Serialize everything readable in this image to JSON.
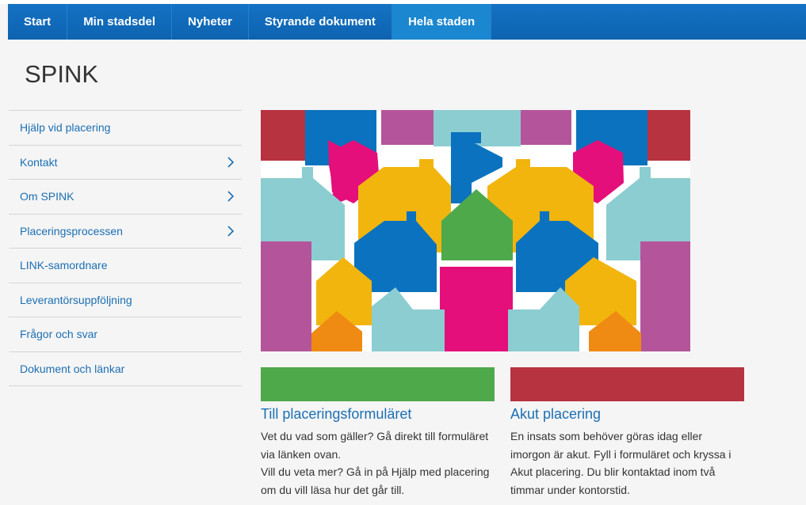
{
  "nav": {
    "items": [
      {
        "label": "Start"
      },
      {
        "label": "Min stadsdel"
      },
      {
        "label": "Nyheter"
      },
      {
        "label": "Styrande dokument"
      },
      {
        "label": "Hela staden"
      }
    ]
  },
  "page": {
    "title": "SPINK"
  },
  "sidebar": {
    "items": [
      {
        "label": "Hjälp vid placering"
      },
      {
        "label": "Kontakt"
      },
      {
        "label": "Om SPINK"
      },
      {
        "label": "Placeringsprocessen"
      },
      {
        "label": "LINK-samordnare"
      },
      {
        "label": "Leverantörsuppföljning"
      },
      {
        "label": "Frågor och svar"
      },
      {
        "label": "Dokument och länkar"
      }
    ]
  },
  "cards": [
    {
      "color": "#4ea94b",
      "title": "Till placeringsformuläret",
      "text1": "Vet du vad som gäller? Gå direkt till formuläret via länken ovan.",
      "text2": "Vill du veta mer? Gå in på Hjälp med placering om du vill läsa hur det går till."
    },
    {
      "color": "#b73340",
      "title": "Akut placering",
      "text1": "En insats som behöver göras idag eller imorgon är akut. Fyll i formuläret och kryssa i Akut placering. Du blir kontaktad inom två timmar under kontorstid.",
      "text2": ""
    }
  ],
  "colors": {
    "nav_bg": "#0d63b0",
    "link": "#1b6fb3"
  }
}
